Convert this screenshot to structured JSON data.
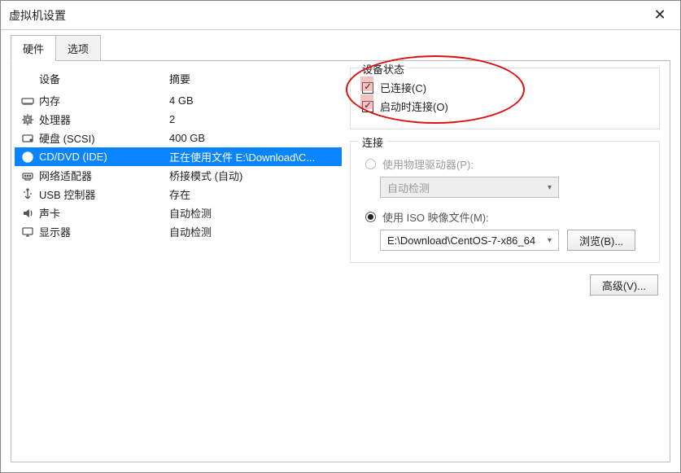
{
  "window": {
    "title": "虚拟机设置"
  },
  "tabs": {
    "hardware": "硬件",
    "options": "选项"
  },
  "headers": {
    "device": "设备",
    "summary": "摘要"
  },
  "devices": [
    {
      "icon": "memory",
      "name": "内存",
      "summary": "4 GB"
    },
    {
      "icon": "cpu",
      "name": "处理器",
      "summary": "2"
    },
    {
      "icon": "disk",
      "name": "硬盘 (SCSI)",
      "summary": "400 GB"
    },
    {
      "icon": "cd",
      "name": "CD/DVD (IDE)",
      "summary": "正在使用文件 E:\\Download\\C..."
    },
    {
      "icon": "net",
      "name": "网络适配器",
      "summary": "桥接模式 (自动)"
    },
    {
      "icon": "usb",
      "name": "USB 控制器",
      "summary": "存在"
    },
    {
      "icon": "sound",
      "name": "声卡",
      "summary": "自动检测"
    },
    {
      "icon": "display",
      "name": "显示器",
      "summary": "自动检测"
    }
  ],
  "selected_device_index": 3,
  "status_group": {
    "title": "设备状态",
    "connected": "已连接(C)",
    "connect_at_poweron": "启动时连接(O)"
  },
  "connection_group": {
    "title": "连接",
    "use_physical": "使用物理驱动器(P):",
    "auto_detect": "自动检测",
    "use_iso": "使用 ISO 映像文件(M):",
    "iso_path": "E:\\Download\\CentOS-7-x86_64",
    "browse": "浏览(B)..."
  },
  "advanced_btn": "高级(V)..."
}
